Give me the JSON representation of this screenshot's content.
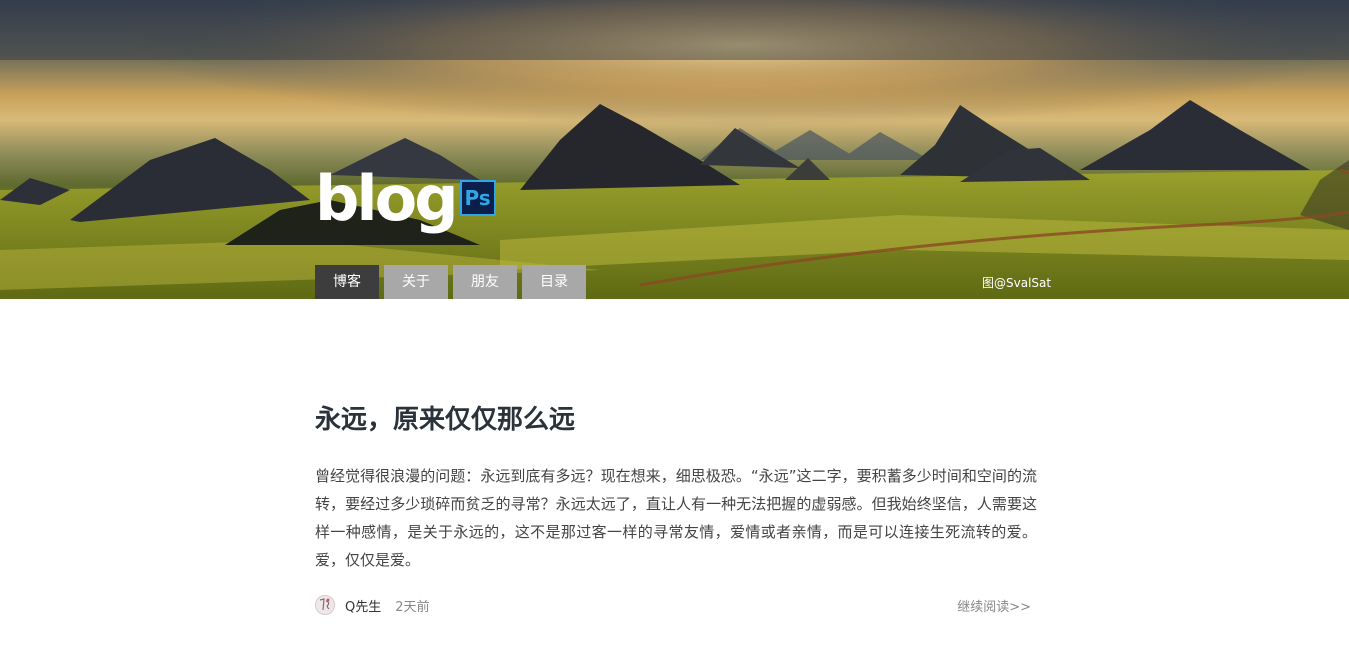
{
  "header": {
    "logo_text": "blog",
    "logo_badge": "Ps",
    "photo_credit": "图@SvalSat"
  },
  "nav": {
    "items": [
      {
        "label": "博客",
        "active": true
      },
      {
        "label": "关于",
        "active": false
      },
      {
        "label": "朋友",
        "active": false
      },
      {
        "label": "目录",
        "active": false
      }
    ]
  },
  "post": {
    "title": "永远，原来仅仅那么远",
    "body": "曾经觉得很浪漫的问题：永远到底有多远？现在想来，细思极恐。“永远”这二字，要积蓄多少时间和空间的流转，要经过多少琐碎而贫乏的寻常？永远太远了，直让人有一种无法把握的虚弱感。但我始终坚信，人需要这样一种感情，是关于永远的，这不是那过客一样的寻常友情，爱情或者亲情，而是可以连接生死流转的爱。爱，仅仅是爱。",
    "author": "Q先生",
    "time": "2天前",
    "read_more": "继续阅读>>"
  },
  "colors": {
    "nav_active": "#3d3d3d",
    "nav_inactive": "#a8a8a8",
    "title": "#2b323a",
    "badge_bg": "#0b1f4a",
    "badge_border": "#2fa6e6"
  }
}
